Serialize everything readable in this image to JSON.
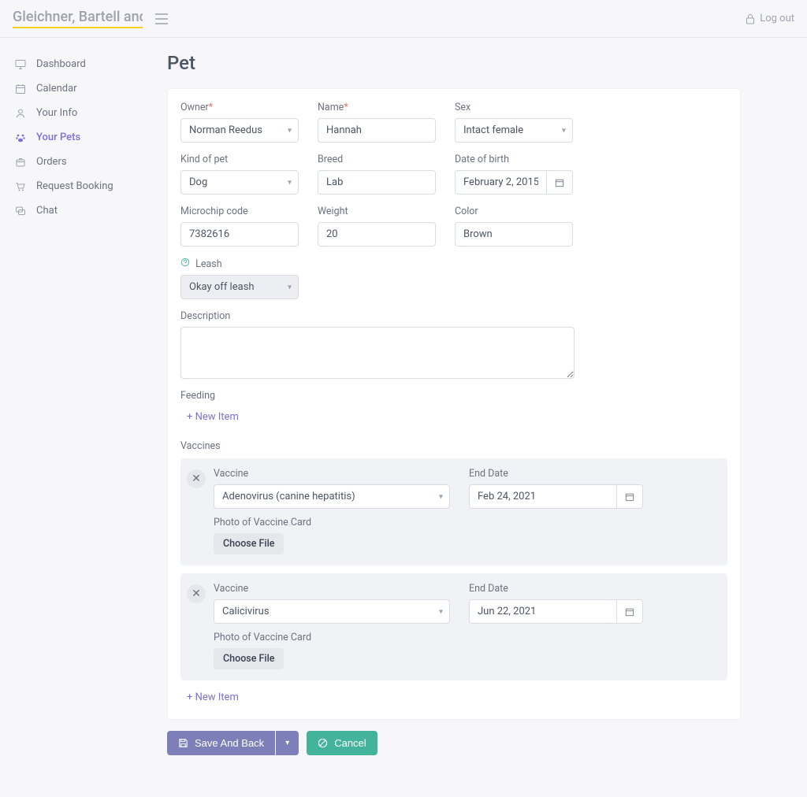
{
  "header": {
    "brand": "Gleichner, Bartell and M",
    "logout": "Log out"
  },
  "sidebar": {
    "items": [
      {
        "label": "Dashboard",
        "icon": "monitor-icon"
      },
      {
        "label": "Calendar",
        "icon": "calendar-icon"
      },
      {
        "label": "Your Info",
        "icon": "user-icon"
      },
      {
        "label": "Your Pets",
        "icon": "paw-icon"
      },
      {
        "label": "Orders",
        "icon": "box-icon"
      },
      {
        "label": "Request Booking",
        "icon": "cart-icon"
      },
      {
        "label": "Chat",
        "icon": "chat-icon"
      }
    ]
  },
  "page": {
    "title": "Pet"
  },
  "form": {
    "owner_label": "Owner",
    "owner_value": "Norman Reedus",
    "name_label": "Name",
    "name_value": "Hannah",
    "sex_label": "Sex",
    "sex_value": "Intact female",
    "kind_label": "Kind of pet",
    "kind_value": "Dog",
    "breed_label": "Breed",
    "breed_value": "Lab",
    "dob_label": "Date of birth",
    "dob_value": "February 2, 2015",
    "micro_label": "Microchip code",
    "micro_value": "7382616",
    "weight_label": "Weight",
    "weight_value": "20",
    "color_label": "Color",
    "color_value": "Brown",
    "leash_label": "Leash",
    "leash_value": "Okay off leash",
    "desc_label": "Description",
    "desc_value": "",
    "feeding_label": "Feeding",
    "vaccines_label": "Vaccines",
    "new_item": "+ New Item"
  },
  "vaccines": [
    {
      "vaccine_label": "Vaccine",
      "vaccine_value": "Adenovirus (canine hepatitis)",
      "end_label": "End Date",
      "end_value": "Feb 24, 2021",
      "photo_label": "Photo of Vaccine Card",
      "choose_label": "Choose File"
    },
    {
      "vaccine_label": "Vaccine",
      "vaccine_value": "Calicivirus",
      "end_label": "End Date",
      "end_value": "Jun 22, 2021",
      "photo_label": "Photo of Vaccine Card",
      "choose_label": "Choose File"
    }
  ],
  "footer": {
    "save_label": "Save And Back",
    "cancel_label": "Cancel"
  }
}
